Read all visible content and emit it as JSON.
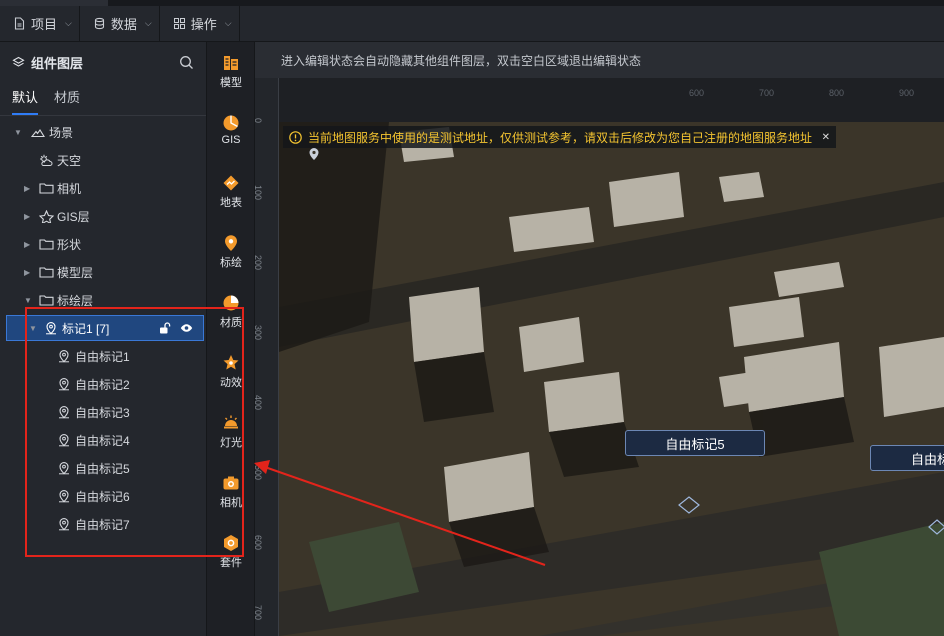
{
  "menubar": {
    "items": [
      {
        "label": "项目",
        "icon": "file-icon"
      },
      {
        "label": "数据",
        "icon": "database-icon"
      },
      {
        "label": "操作",
        "icon": "grid-icon"
      }
    ]
  },
  "layer_panel": {
    "title": "组件图层",
    "tabs": [
      {
        "label": "默认",
        "active": true
      },
      {
        "label": "材质",
        "active": false
      }
    ],
    "tree": [
      {
        "label": "场景",
        "icon": "scene-icon",
        "expanded": true
      },
      {
        "label": "天空",
        "icon": "weather-icon"
      },
      {
        "label": "相机",
        "icon": "folder-icon",
        "expanded": false
      },
      {
        "label": "GIS层",
        "icon": "gis-icon",
        "expanded": false
      },
      {
        "label": "形状",
        "icon": "folder-icon",
        "expanded": false
      },
      {
        "label": "模型层",
        "icon": "folder-icon",
        "expanded": false
      },
      {
        "label": "标绘层",
        "icon": "folder-icon",
        "expanded": true
      },
      {
        "label": "标记1 [7]",
        "icon": "marker-icon",
        "expanded": true,
        "selected": true
      },
      {
        "label": "自由标记1",
        "icon": "marker-icon"
      },
      {
        "label": "自由标记2",
        "icon": "marker-icon"
      },
      {
        "label": "自由标记3",
        "icon": "marker-icon"
      },
      {
        "label": "自由标记4",
        "icon": "marker-icon"
      },
      {
        "label": "自由标记5",
        "icon": "marker-icon"
      },
      {
        "label": "自由标记6",
        "icon": "marker-icon"
      },
      {
        "label": "自由标记7",
        "icon": "marker-icon"
      }
    ]
  },
  "icon_bar": {
    "items": [
      {
        "label": "模型",
        "icon": "model-icon"
      },
      {
        "label": "GIS",
        "icon": "gis-globe-icon"
      },
      {
        "label": "地表",
        "icon": "terrain-icon"
      },
      {
        "label": "标绘",
        "icon": "location-pin-icon"
      },
      {
        "label": "材质",
        "icon": "material-icon"
      },
      {
        "label": "动效",
        "icon": "effect-icon"
      },
      {
        "label": "灯光",
        "icon": "light-icon"
      },
      {
        "label": "相机",
        "icon": "camera-icon"
      },
      {
        "label": "套件",
        "icon": "kit-icon"
      }
    ]
  },
  "canvas": {
    "hint": "进入编辑状态会自动隐藏其他组件图层，双击空白区域退出编辑状态",
    "h_ruler": [
      "600",
      "700",
      "800",
      "900"
    ],
    "v_ruler": [
      "0",
      "100",
      "200",
      "300",
      "400",
      "500",
      "600",
      "700"
    ],
    "notice": "当前地图服务中使用的是测试地址，仅供测试参考，请双击后修改为您自己注册的地图服务地址",
    "markers": [
      "自由标记5",
      "自由标"
    ]
  },
  "colors": {
    "accent": "#2f7cf6",
    "warning": "#f4c430",
    "annotation": "#e3241b",
    "icon_orange": "#f39a2c"
  }
}
